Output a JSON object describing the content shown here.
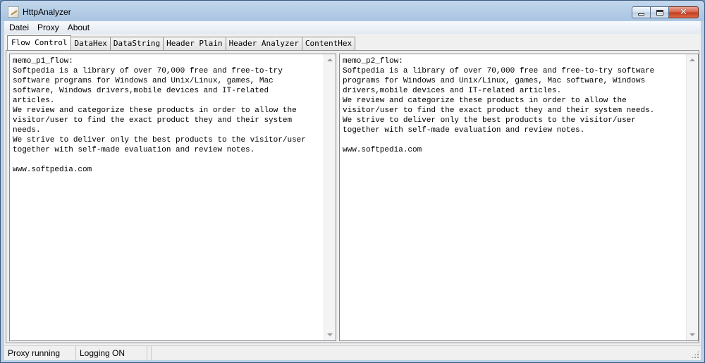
{
  "window": {
    "title": "HttpAnalyzer",
    "controls": {
      "minimize": "minimize-icon",
      "maximize": "maximize-icon",
      "close": "close-icon"
    }
  },
  "menu": {
    "items": [
      "Datei",
      "Proxy",
      "About"
    ]
  },
  "tabs": {
    "items": [
      "Flow Control",
      "DataHex",
      "DataString",
      "Header Plain",
      "Header Analyzer",
      "ContentHex"
    ],
    "active": "Flow Control"
  },
  "memos": {
    "left": {
      "text": "memo_p1_flow:\nSoftpedia is a library of over 70,000 free and free-to-try\nsoftware programs for Windows and Unix/Linux, games, Mac\nsoftware, Windows drivers,mobile devices and IT-related\narticles.\nWe review and categorize these products in order to allow the\nvisitor/user to find the exact product they and their system\nneeds.\nWe strive to deliver only the best products to the visitor/user\ntogether with self-made evaluation and review notes.\n\nwww.softpedia.com"
    },
    "right": {
      "text": "memo_p2_flow:\nSoftpedia is a library of over 70,000 free and free-to-try software\nprograms for Windows and Unix/Linux, games, Mac software, Windows\ndrivers,mobile devices and IT-related articles.\nWe review and categorize these products in order to allow the\nvisitor/user to find the exact product they and their system needs.\nWe strive to deliver only the best products to the visitor/user\ntogether with self-made evaluation and review notes.\n\nwww.softpedia.com"
    }
  },
  "status": {
    "panels": [
      "Proxy running",
      "Logging ON",
      ""
    ]
  }
}
